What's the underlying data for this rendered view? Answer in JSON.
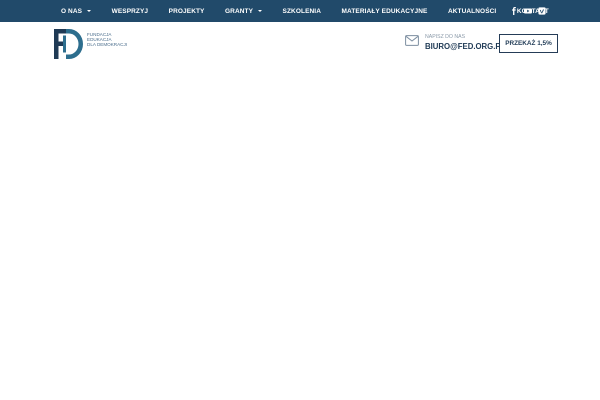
{
  "nav": {
    "items": [
      {
        "label": "O NAS",
        "dropdown": true
      },
      {
        "label": "WESPRZYJ",
        "dropdown": false
      },
      {
        "label": "PROJEKTY",
        "dropdown": false
      },
      {
        "label": "GRANTY",
        "dropdown": true
      },
      {
        "label": "SZKOLENIA",
        "dropdown": false
      },
      {
        "label": "MATERIAŁY EDUKACYJNE",
        "dropdown": false
      },
      {
        "label": "AKTUALNOŚCI",
        "dropdown": false
      },
      {
        "label": "KONTAKT",
        "dropdown": false
      }
    ]
  },
  "social": [
    "facebook-icon",
    "youtube-icon",
    "vimeo-icon"
  ],
  "logo": {
    "letters": "FED",
    "line1": "FUNDACJA",
    "line2": "EDUKACJA",
    "line3": "DLA DEMOKRACJI"
  },
  "contact": {
    "label": "NAPISZ DO NAS",
    "email": "BIURO@FED.ORG.PL"
  },
  "cta": {
    "label": "PRZEKAŻ 1,5%"
  },
  "colors": {
    "topbar": "#214a6a",
    "brand_dark": "#1f3a55",
    "brand_teal": "#2d6e8e"
  }
}
